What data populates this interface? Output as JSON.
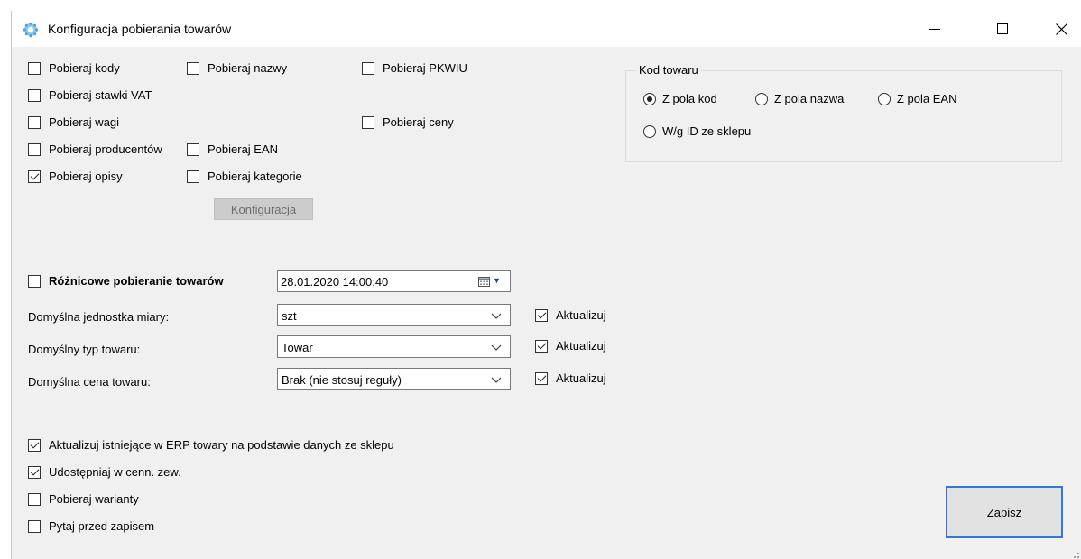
{
  "window": {
    "title": "Konfiguracja pobierania towarów",
    "controls": {
      "minimize_icon": "minimize-icon",
      "maximize_icon": "maximize-icon",
      "close_icon": "close-icon"
    }
  },
  "options": {
    "kody": {
      "label": "Pobieraj kody",
      "checked": false
    },
    "nazwy": {
      "label": "Pobieraj nazwy",
      "checked": false
    },
    "pkwiu": {
      "label": "Pobieraj PKWIU",
      "checked": false
    },
    "stawki_vat": {
      "label": "Pobieraj stawki VAT",
      "checked": false
    },
    "wagi": {
      "label": "Pobieraj wagi",
      "checked": false
    },
    "ceny": {
      "label": "Pobieraj ceny",
      "checked": false
    },
    "producentow": {
      "label": "Pobieraj producentów",
      "checked": false
    },
    "ean": {
      "label": "Pobieraj EAN",
      "checked": false
    },
    "opisy": {
      "label": "Pobieraj opisy",
      "checked": true
    },
    "kategorie": {
      "label": "Pobieraj kategorie",
      "checked": false
    },
    "config_button": "Konfiguracja"
  },
  "kod_towaru": {
    "legend": "Kod towaru",
    "options": [
      {
        "label": "Z pola kod",
        "selected": true
      },
      {
        "label": "Z pola nazwa",
        "selected": false
      },
      {
        "label": "Z pola EAN",
        "selected": false
      },
      {
        "label": "W/g ID ze sklepu",
        "selected": false
      }
    ]
  },
  "roznicowe": {
    "label": "Różnicowe pobieranie towarów",
    "checked": false,
    "datetime": "28.01.2020 14:00:40"
  },
  "defaults": {
    "jednostka": {
      "label": "Domyślna jednostka miary:",
      "value": "szt",
      "update_label": "Aktualizuj",
      "update_checked": true
    },
    "typ": {
      "label": "Domyślny typ towaru:",
      "value": "Towar",
      "update_label": "Aktualizuj",
      "update_checked": true
    },
    "cena": {
      "label": "Domyślna cena towaru:",
      "value": "Brak (nie stosuj reguły)",
      "update_label": "Aktualizuj",
      "update_checked": true
    }
  },
  "bottom_options": {
    "aktualizuj_istniejace": {
      "label": "Aktualizuj istniejące w ERP towary na podstawie danych ze sklepu",
      "checked": true
    },
    "udostepniaj": {
      "label": "Udostępniaj w cenn. zew.",
      "checked": true
    },
    "warianty": {
      "label": "Pobieraj warianty",
      "checked": false
    },
    "pytaj": {
      "label": "Pytaj przed zapisem",
      "checked": false
    }
  },
  "save_button": "Zapisz",
  "colors": {
    "accent": "#2f7ad8",
    "window_bg": "#f0f0f0",
    "disabled_button": "#cccccc"
  }
}
